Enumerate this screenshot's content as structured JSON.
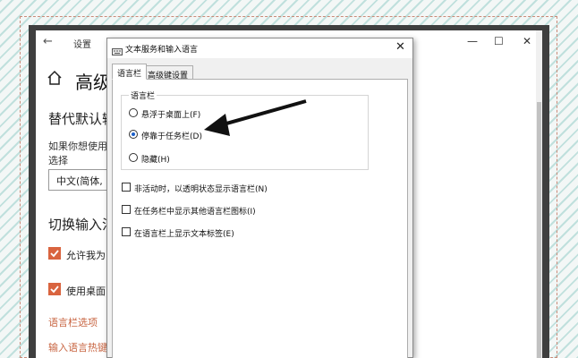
{
  "settings": {
    "title": "设置",
    "back_glyph": "←",
    "minimize_glyph": "—",
    "maximize_glyph": "☐",
    "close_glyph": "✕",
    "heading": "高级",
    "section1_title": "替代默认输",
    "section1_text": "如果你想使用处选择",
    "language_select_value": "中文(简体,",
    "section2_title": "切换输入法",
    "checkbox1_label": "允许我为",
    "checkbox2_label": "使用桌面",
    "link1": "语言栏选项",
    "link2": "输入语言热键"
  },
  "dialog": {
    "title": "文本服务和输入语言",
    "close_glyph": "✕",
    "tabs": [
      "语言栏",
      "高级键设置"
    ],
    "group_label": "语言栏",
    "radios": [
      {
        "label": "悬浮于桌面上(F)",
        "selected": false
      },
      {
        "label": "停靠于任务栏(D)",
        "selected": true
      },
      {
        "label": "隐藏(H)",
        "selected": false
      }
    ],
    "checkboxes": [
      {
        "label": "非活动时，以透明状态显示语言栏(N)",
        "checked": false
      },
      {
        "label": "在任务栏中显示其他语言栏图标(I)",
        "checked": false
      },
      {
        "label": "在语言栏上显示文本标签(E)",
        "checked": false
      }
    ]
  },
  "colors": {
    "accent": "#d9643f",
    "link": "#c86542",
    "radio_selected": "#1a5fc9"
  }
}
